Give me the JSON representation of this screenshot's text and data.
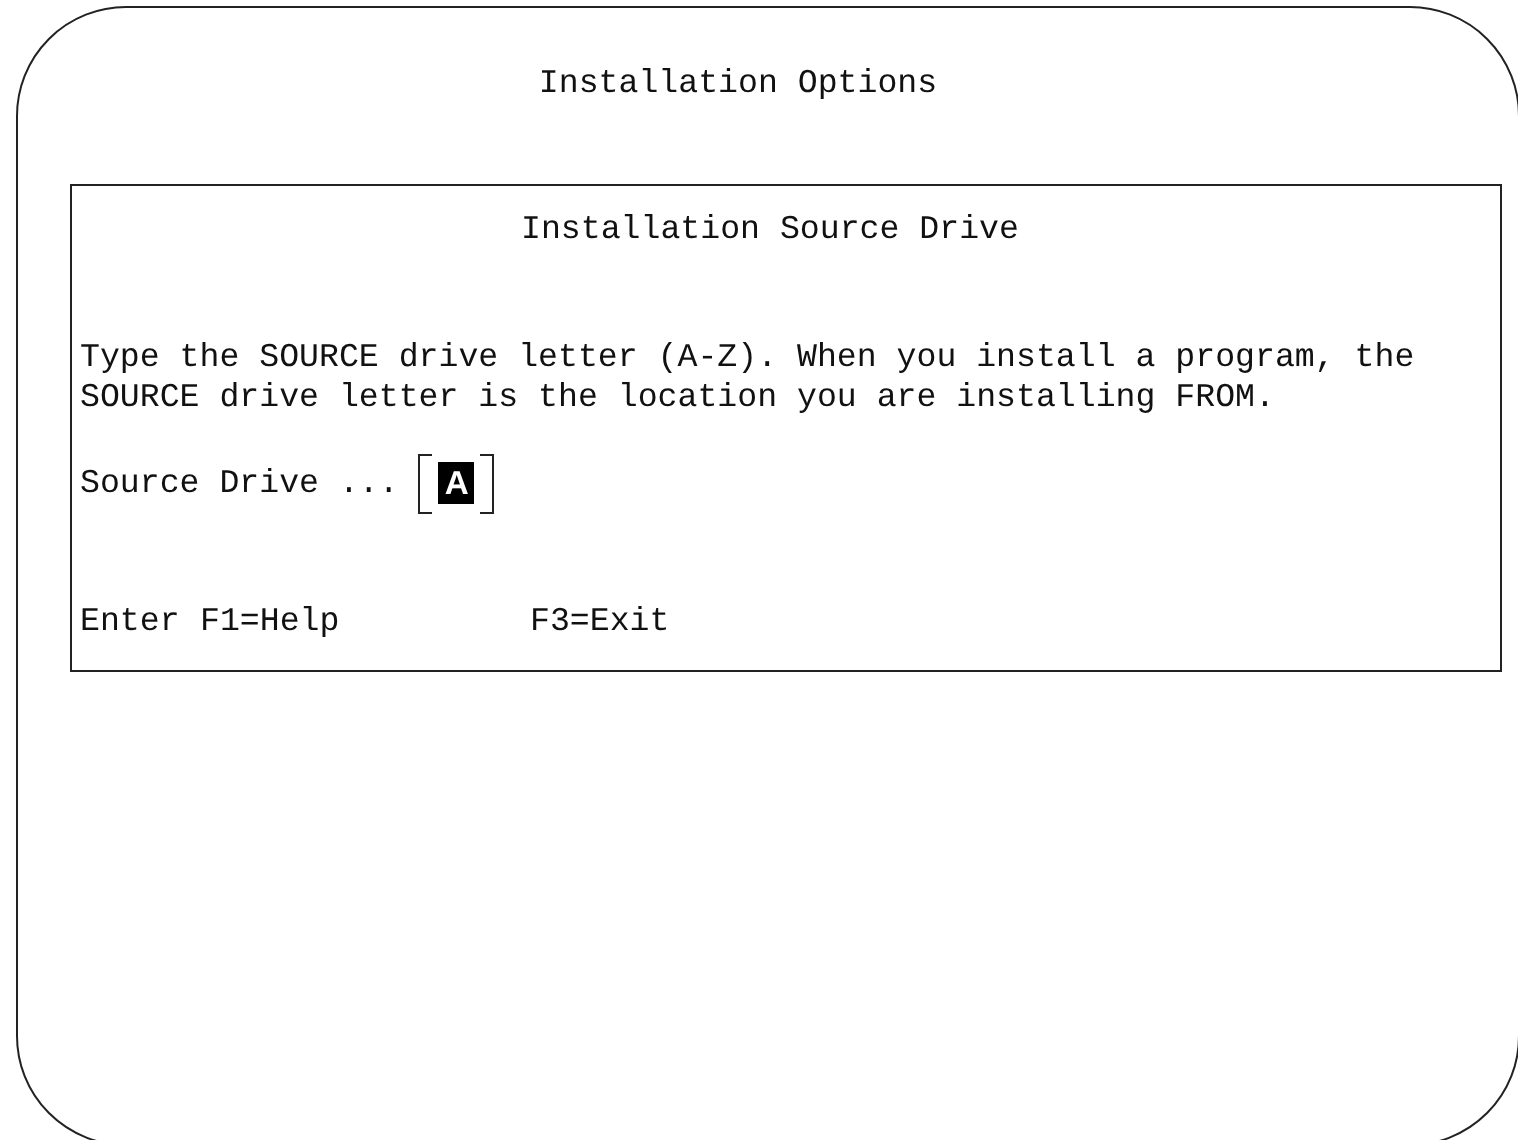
{
  "screen": {
    "title": "Installation Options"
  },
  "panel": {
    "title": "Installation Source Drive",
    "instructions": [
      "Type the SOURCE drive letter (A-Z). When you install a program, the",
      "SOURCE drive letter is the location you are installing FROM."
    ],
    "field": {
      "label": "Source Drive ...",
      "value": "A"
    },
    "keys": [
      {
        "label": "Enter"
      },
      {
        "label": "F1=Help"
      },
      {
        "label": "F3=Exit"
      }
    ]
  }
}
